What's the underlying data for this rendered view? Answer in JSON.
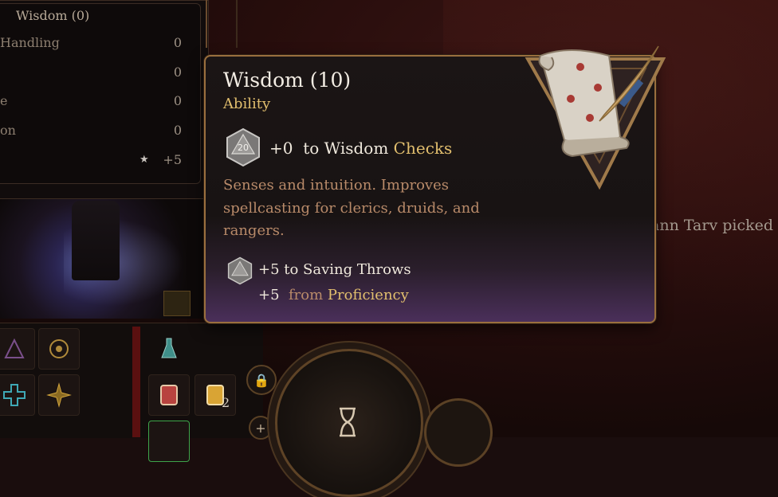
{
  "skills_panel": {
    "header": "Wisdom (0)",
    "rows": [
      {
        "name": "Handling",
        "value": "0"
      },
      {
        "name": "",
        "value": "0"
      },
      {
        "name": "e",
        "value": "0"
      },
      {
        "name": "on",
        "value": "0"
      }
    ],
    "bonus": "+5",
    "star_icon": "star-icon"
  },
  "tooltip": {
    "title": "Wisdom (10)",
    "subtitle": "Ability",
    "die_label": "20",
    "check": {
      "modifier": "+0",
      "text": "to Wisdom",
      "keyword": "Checks"
    },
    "description": "Senses and intuition. Improves spellcasting for clerics, druids, and rangers.",
    "saving": {
      "text": "+5 to Saving Throws"
    },
    "proficiency": {
      "value": "+5",
      "from": "from",
      "keyword": "Proficiency"
    }
  },
  "background": {
    "log_text": "ann Tarv picked u"
  },
  "hotbar": {
    "stack_count": "2"
  },
  "colors": {
    "accent_gold": "#e2bf6e",
    "description_text": "#b88a69",
    "border": "#9a6f3e"
  }
}
